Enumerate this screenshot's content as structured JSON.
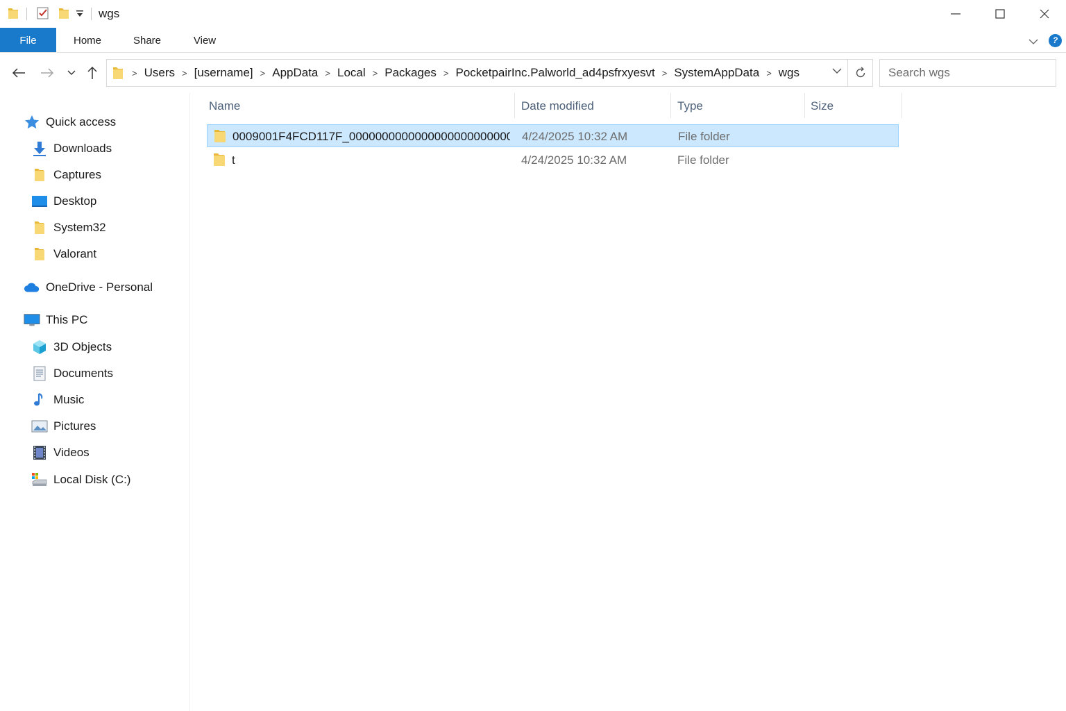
{
  "window": {
    "title": "wgs"
  },
  "ribbon": {
    "tabs": [
      "File",
      "Home",
      "Share",
      "View"
    ],
    "help_label": "?"
  },
  "address": {
    "crumbs": [
      "Users",
      "[username]",
      "AppData",
      "Local",
      "Packages",
      "PocketpairInc.Palworld_ad4psfrxyesvt",
      "SystemAppData",
      "wgs"
    ]
  },
  "search": {
    "placeholder": "Search wgs"
  },
  "sidebar": {
    "quick_access": "Quick access",
    "quick_items": [
      "Downloads",
      "Captures",
      "Desktop",
      "System32",
      "Valorant"
    ],
    "onedrive": "OneDrive - Personal",
    "this_pc": "This PC",
    "pc_items": [
      "3D Objects",
      "Documents",
      "Music",
      "Pictures",
      "Videos",
      "Local Disk (C:)"
    ]
  },
  "columns": {
    "name": "Name",
    "date": "Date modified",
    "type": "Type",
    "size": "Size"
  },
  "files": [
    {
      "name": "0009001F4FCD117F_0000000000000000000000000...",
      "date": "4/24/2025 10:32 AM",
      "type": "File folder",
      "size": ""
    },
    {
      "name": "t",
      "date": "4/24/2025 10:32 AM",
      "type": "File folder",
      "size": ""
    }
  ],
  "colors": {
    "accent": "#1979ca",
    "selection": "#cce8ff",
    "folder": "#f8d775"
  }
}
